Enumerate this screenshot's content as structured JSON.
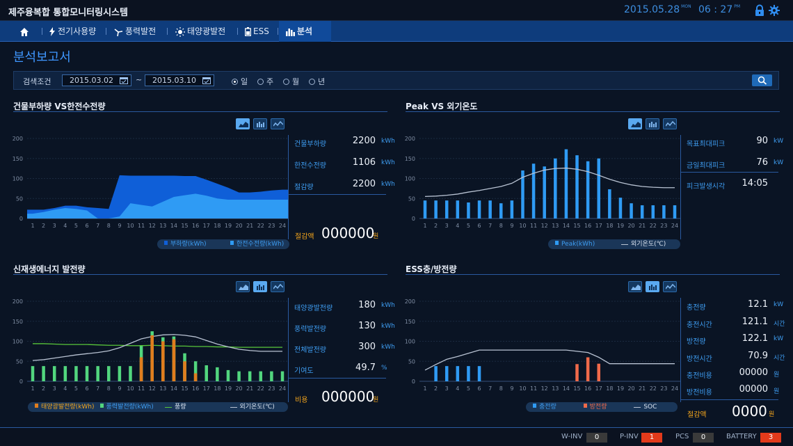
{
  "header": {
    "title": "제주융복합 통합모니터링시스템",
    "date": "2015.05.28",
    "day": "MON",
    "time": "06 : 27",
    "ampm": "PM"
  },
  "nav": {
    "items": [
      {
        "label": "전기사용량",
        "icon": "lightning-icon"
      },
      {
        "label": "풍력발전",
        "icon": "wind-turbine-icon"
      },
      {
        "label": "태양광발전",
        "icon": "sun-icon"
      },
      {
        "label": "ESS",
        "icon": "battery-icon"
      },
      {
        "label": "분석",
        "icon": "bar-chart-icon",
        "active": true
      }
    ]
  },
  "page": {
    "title": "분석보고서"
  },
  "search": {
    "label": "검색조건",
    "from": "2015.03.02",
    "to": "2015.03.10",
    "tilde": "~",
    "periods": [
      {
        "label": "일",
        "selected": true
      },
      {
        "label": "주"
      },
      {
        "label": "월"
      },
      {
        "label": "년"
      }
    ]
  },
  "panels": [
    {
      "title": "건물부하량 VS한전수전량",
      "stats": [
        {
          "label": "건물부하량",
          "value": "2200",
          "unit": "kWh"
        },
        {
          "label": "한전수전량",
          "value": "1106",
          "unit": "kWh"
        },
        {
          "label": "절감량",
          "value": "2200",
          "unit": "kWh"
        }
      ],
      "total": {
        "label": "절감액",
        "value": "000000",
        "unit": "원"
      },
      "legend": [
        "부하량(kWh)",
        "한전수전량(kWh)"
      ]
    },
    {
      "title": "Peak VS 외기온도",
      "stats": [
        {
          "label": "목표최대피크",
          "value": "90",
          "unit": "kW"
        },
        {
          "label": "금일최대피크",
          "value": "76",
          "unit": "kW"
        },
        {
          "label": "피크발생시각",
          "value": "14:05",
          "unit": ""
        }
      ],
      "legend": [
        "Peak(kWh)",
        "외기온도(℃)"
      ]
    },
    {
      "title": "신재생에너지 발전량",
      "stats": [
        {
          "label": "태양광발전량",
          "value": "180",
          "unit": "kWh"
        },
        {
          "label": "풍력발전량",
          "value": "130",
          "unit": "kWh"
        },
        {
          "label": "전체발전량",
          "value": "300",
          "unit": "kWh"
        },
        {
          "label": "기여도",
          "value": "49.7",
          "unit": "%"
        }
      ],
      "total": {
        "label": "비용",
        "value": "000000",
        "unit": "원"
      },
      "legend": [
        "태양광발전량(kWh)",
        "풍력발전량(kWh)",
        "풍량",
        "외기온도(℃)"
      ]
    },
    {
      "title": "ESS충/방전량",
      "stats": [
        {
          "label": "충전량",
          "value": "12.1",
          "unit": "kW"
        },
        {
          "label": "충전시간",
          "value": "121.1",
          "unit": "시간"
        },
        {
          "label": "방전량",
          "value": "122.1",
          "unit": "kW"
        },
        {
          "label": "방전시간",
          "value": "70.9",
          "unit": "시간"
        },
        {
          "label": "충전비용",
          "value": "00000",
          "unit": "원"
        },
        {
          "label": "방전비용",
          "value": "00000",
          "unit": "원"
        }
      ],
      "total": {
        "label": "절감액",
        "value": "0000",
        "unit": "원"
      },
      "legend": [
        "충전량",
        "방전량",
        "SOC"
      ]
    }
  ],
  "chart_data": [
    {
      "type": "area",
      "x": [
        1,
        2,
        3,
        4,
        5,
        6,
        7,
        8,
        9,
        10,
        11,
        12,
        13,
        14,
        15,
        16,
        17,
        18,
        19,
        20,
        21,
        22,
        23,
        24
      ],
      "ylim": [
        0,
        200
      ],
      "yticks": [
        0,
        50,
        100,
        150,
        200
      ],
      "series": [
        {
          "name": "부하량(kWh)",
          "color": "#0f5fd8",
          "values": [
            22,
            22,
            26,
            32,
            32,
            28,
            26,
            24,
            108,
            107,
            107,
            107,
            107,
            107,
            106,
            106,
            97,
            87,
            77,
            65,
            65,
            67,
            70,
            72
          ]
        },
        {
          "name": "한전수전량(kWh)",
          "color": "#2f9bf4",
          "values": [
            12,
            16,
            22,
            26,
            24,
            20,
            0,
            0,
            5,
            38,
            34,
            30,
            42,
            54,
            58,
            62,
            57,
            50,
            47,
            47,
            47,
            47,
            47,
            47
          ]
        }
      ]
    },
    {
      "type": "bar",
      "x": [
        1,
        2,
        3,
        4,
        5,
        6,
        7,
        8,
        9,
        10,
        11,
        12,
        13,
        14,
        15,
        16,
        17,
        18,
        19,
        20,
        21,
        22,
        23,
        24
      ],
      "ylim": [
        0,
        200
      ],
      "yticks": [
        0,
        50,
        100,
        150,
        200
      ],
      "series": [
        {
          "name": "Peak(kWh)",
          "type": "bar",
          "color": "#2f9bf4",
          "values": [
            45,
            45,
            45,
            45,
            40,
            45,
            45,
            38,
            45,
            120,
            137,
            130,
            150,
            173,
            158,
            143,
            150,
            73,
            52,
            38,
            33,
            33,
            33,
            33
          ]
        },
        {
          "name": "외기온도(℃)",
          "type": "line",
          "color": "#b9c3d3",
          "values": [
            55,
            56,
            58,
            61,
            66,
            70,
            75,
            80,
            88,
            103,
            113,
            121,
            125,
            126,
            123,
            117,
            108,
            98,
            90,
            84,
            80,
            78,
            77,
            77
          ]
        }
      ]
    },
    {
      "type": "bar",
      "x": [
        1,
        2,
        3,
        4,
        5,
        6,
        7,
        8,
        9,
        10,
        11,
        12,
        13,
        14,
        15,
        16,
        17,
        18,
        19,
        20,
        21,
        22,
        23,
        24
      ],
      "ylim": [
        0,
        200
      ],
      "yticks": [
        0,
        50,
        100,
        150,
        200
      ],
      "series": [
        {
          "name": "태양광발전량(kWh)",
          "type": "bar",
          "color": "#e07d1e",
          "values": [
            0,
            0,
            0,
            0,
            0,
            0,
            0,
            0,
            0,
            0,
            60,
            115,
            100,
            105,
            50,
            20,
            0,
            0,
            0,
            0,
            0,
            0,
            0,
            0
          ]
        },
        {
          "name": "풍력발전량(kWh)",
          "type": "bar",
          "color": "#52d67e",
          "values": [
            38,
            38,
            38,
            38,
            38,
            38,
            38,
            38,
            38,
            38,
            90,
            125,
            110,
            112,
            70,
            50,
            40,
            35,
            28,
            25,
            25,
            25,
            25,
            25
          ]
        },
        {
          "name": "풍량",
          "type": "line",
          "color": "#58c63a",
          "values": [
            94,
            94,
            93,
            92,
            92,
            92,
            91,
            90,
            90,
            89,
            89,
            90,
            89,
            88,
            88,
            87,
            87,
            86,
            86,
            85,
            85,
            85,
            85,
            85
          ]
        },
        {
          "name": "외기온도(℃)",
          "type": "line",
          "color": "#b9c3d3",
          "values": [
            52,
            54,
            58,
            62,
            66,
            69,
            72,
            76,
            84,
            95,
            106,
            112,
            116,
            117,
            115,
            111,
            102,
            93,
            86,
            80,
            77,
            75,
            75,
            75
          ]
        }
      ]
    },
    {
      "type": "bar",
      "x": [
        1,
        2,
        3,
        4,
        5,
        6,
        7,
        8,
        9,
        10,
        11,
        12,
        13,
        14,
        15,
        16,
        17,
        18,
        19,
        20,
        21,
        22,
        23,
        24
      ],
      "ylim": [
        0,
        200
      ],
      "yticks": [
        0,
        50,
        100,
        150,
        200
      ],
      "series": [
        {
          "name": "충전량",
          "type": "bar",
          "color": "#2f9bf4",
          "values": [
            0,
            38,
            38,
            38,
            38,
            38,
            0,
            0,
            0,
            0,
            0,
            0,
            0,
            0,
            0,
            0,
            0,
            0,
            0,
            0,
            0,
            0,
            0,
            0
          ]
        },
        {
          "name": "방전량",
          "type": "bar",
          "color": "#f06a4a",
          "values": [
            0,
            0,
            0,
            0,
            0,
            0,
            0,
            0,
            0,
            0,
            0,
            0,
            0,
            0,
            43,
            60,
            44,
            0,
            0,
            0,
            0,
            0,
            0,
            0
          ]
        },
        {
          "name": "SOC",
          "type": "line",
          "color": "#b9c3d3",
          "values": [
            28,
            42,
            55,
            62,
            70,
            78,
            78,
            78,
            78,
            78,
            78,
            78,
            78,
            78,
            75,
            72,
            60,
            44,
            44,
            44,
            44,
            44,
            44,
            44
          ]
        }
      ]
    }
  ],
  "status": {
    "items": [
      {
        "label": "W-INV",
        "value": "0",
        "color": "#3a3a3a"
      },
      {
        "label": "P-INV",
        "value": "1",
        "color": "#e23a1b"
      },
      {
        "label": "PCS",
        "value": "0",
        "color": "#3a3a3a"
      },
      {
        "label": "BATTERY",
        "value": "3",
        "color": "#e23a1b"
      }
    ]
  }
}
